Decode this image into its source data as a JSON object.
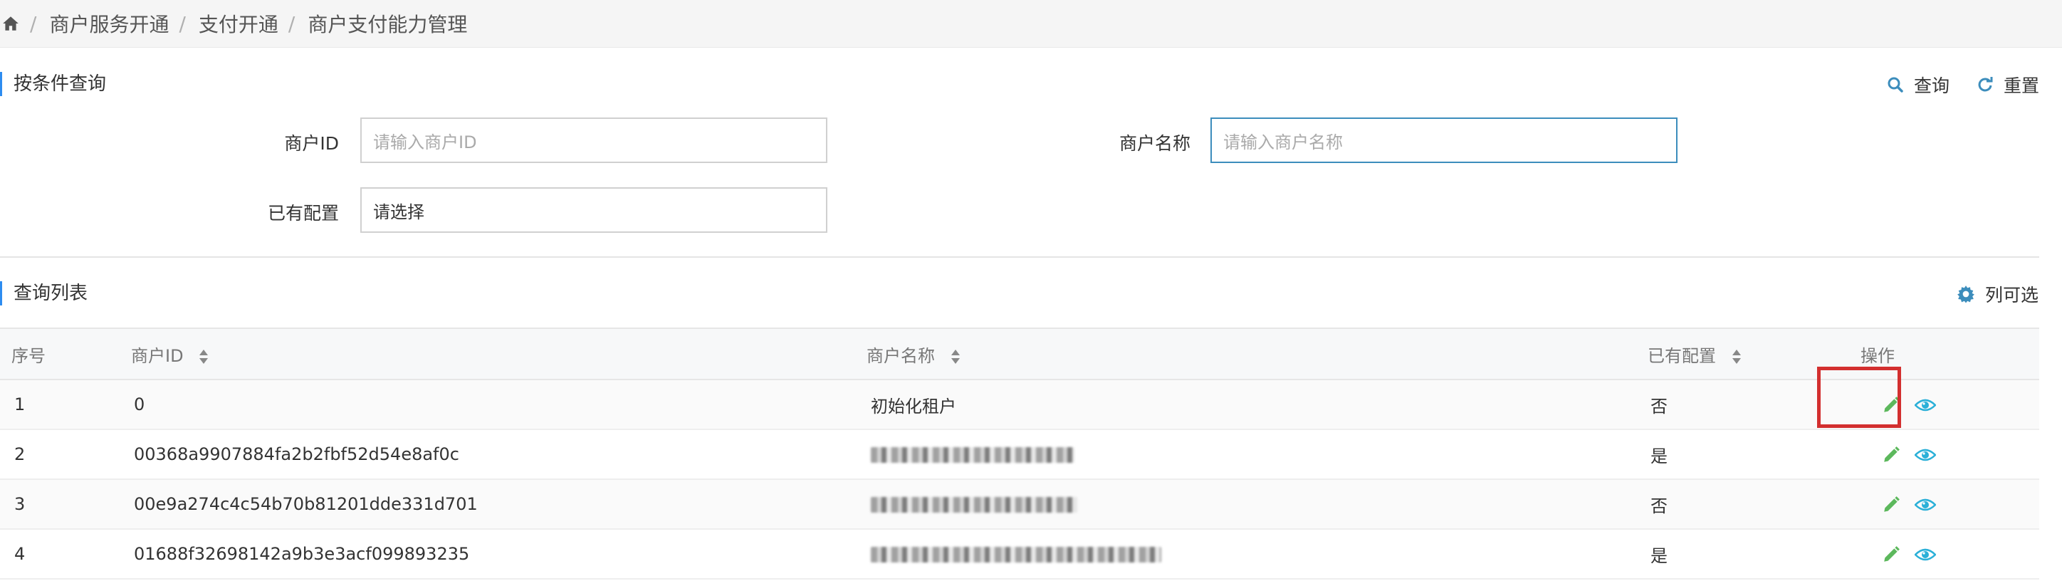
{
  "breadcrumb": [
    "商户服务开通",
    "支付开通",
    "商户支付能力管理"
  ],
  "search_section": {
    "title": "按条件查询",
    "query_label": "查询",
    "reset_label": "重置",
    "fields": {
      "merchant_id": {
        "label": "商户ID",
        "placeholder": "请输入商户ID"
      },
      "merchant_name": {
        "label": "商户名称",
        "placeholder": "请输入商户名称"
      },
      "configured": {
        "label": "已有配置",
        "value": "请选择"
      }
    }
  },
  "list_section": {
    "title": "查询列表",
    "columns_label": "列可选",
    "headers": [
      "序号",
      "商户ID",
      "商户名称",
      "已有配置",
      "操作"
    ],
    "rows": [
      {
        "index": "1",
        "merchant_id": "0",
        "name": "初始化租户",
        "configured": "否"
      },
      {
        "index": "2",
        "merchant_id": "00368a9907884fa2b2fbf52d54e8af0c",
        "name": "",
        "configured": "是"
      },
      {
        "index": "3",
        "merchant_id": "00e9a274c4c54b70b81201dde331d701",
        "name": "",
        "configured": "否"
      },
      {
        "index": "4",
        "merchant_id": "01688f32698142a9b3e3acf099893235",
        "name": "",
        "configured": "是"
      }
    ]
  },
  "colors": {
    "accent": "#3c8dbc",
    "edit": "#5cb85c",
    "view": "#2bb0d8",
    "highlight": "#d32f2f"
  },
  "icons": [
    "home-icon",
    "search-icon",
    "refresh-icon",
    "gear-icon",
    "sort-icon",
    "edit-icon",
    "eye-icon"
  ]
}
